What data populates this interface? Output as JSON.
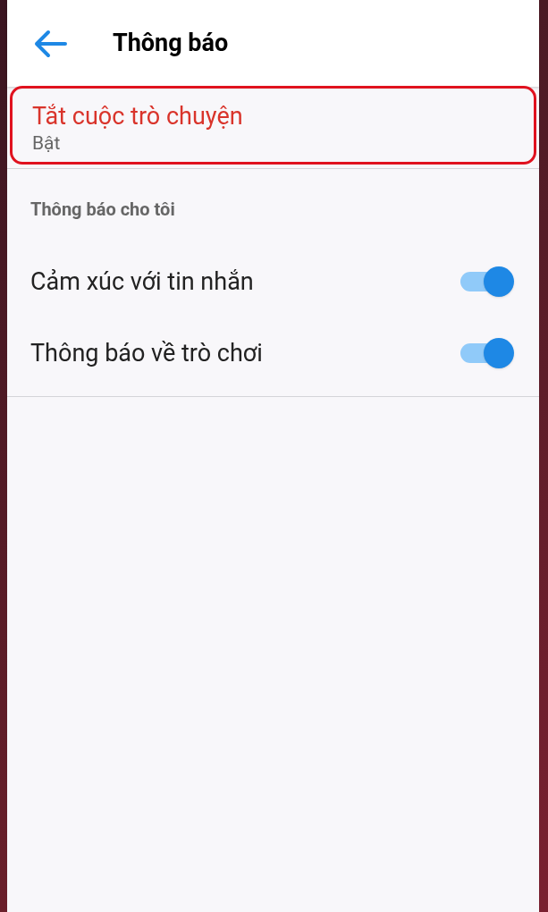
{
  "header": {
    "title": "Thông báo"
  },
  "mute_item": {
    "title": "Tắt cuộc trò chuyện",
    "value": "Bật",
    "highlighted": true
  },
  "section": {
    "title": "Thông báo cho tôi"
  },
  "toggles": [
    {
      "label": "Cảm xúc với tin nhắn",
      "on": true
    },
    {
      "label": "Thông báo về trò chơi",
      "on": true
    }
  ]
}
